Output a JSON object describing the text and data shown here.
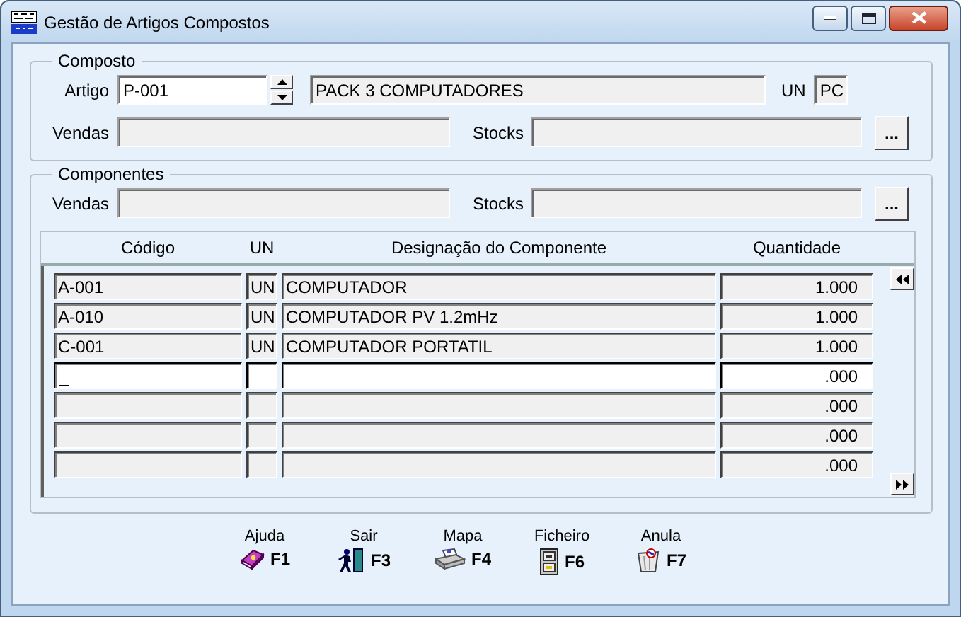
{
  "window": {
    "title": "Gestão de Artigos Compostos"
  },
  "composto": {
    "legend": "Composto",
    "artigo_label": "Artigo",
    "artigo": "P-001",
    "description": "PACK 3 COMPUTADORES",
    "un_label": "UN",
    "un": "PC",
    "vendas_label": "Vendas",
    "stocks_label": "Stocks",
    "browse": "..."
  },
  "componentes": {
    "legend": "Componentes",
    "vendas_label": "Vendas",
    "stocks_label": "Stocks",
    "browse": "...",
    "columns": [
      "Código",
      "UN",
      "Designação do Componente",
      "Quantidade"
    ],
    "rows": [
      {
        "codigo": "A-001",
        "un": "UN",
        "designacao": "COMPUTADOR",
        "quantidade": "1.000",
        "selected": false
      },
      {
        "codigo": "A-010",
        "un": "UN",
        "designacao": "COMPUTADOR PV 1.2mHz",
        "quantidade": "1.000",
        "selected": false
      },
      {
        "codigo": "C-001",
        "un": "UN",
        "designacao": "COMPUTADOR PORTATIL",
        "quantidade": "1.000",
        "selected": false
      },
      {
        "quantidade": ".000",
        "selected": true
      },
      {
        "quantidade": ".000",
        "selected": false
      },
      {
        "quantidade": ".000",
        "selected": false
      },
      {
        "quantidade": ".000",
        "selected": false
      }
    ]
  },
  "toolbar": [
    {
      "label": "Ajuda",
      "key": "F1"
    },
    {
      "label": "Sair",
      "key": "F3"
    },
    {
      "label": "Mapa",
      "key": "F4"
    },
    {
      "label": "Ficheiro",
      "key": "F6"
    },
    {
      "label": "Anula",
      "key": "F7"
    }
  ]
}
